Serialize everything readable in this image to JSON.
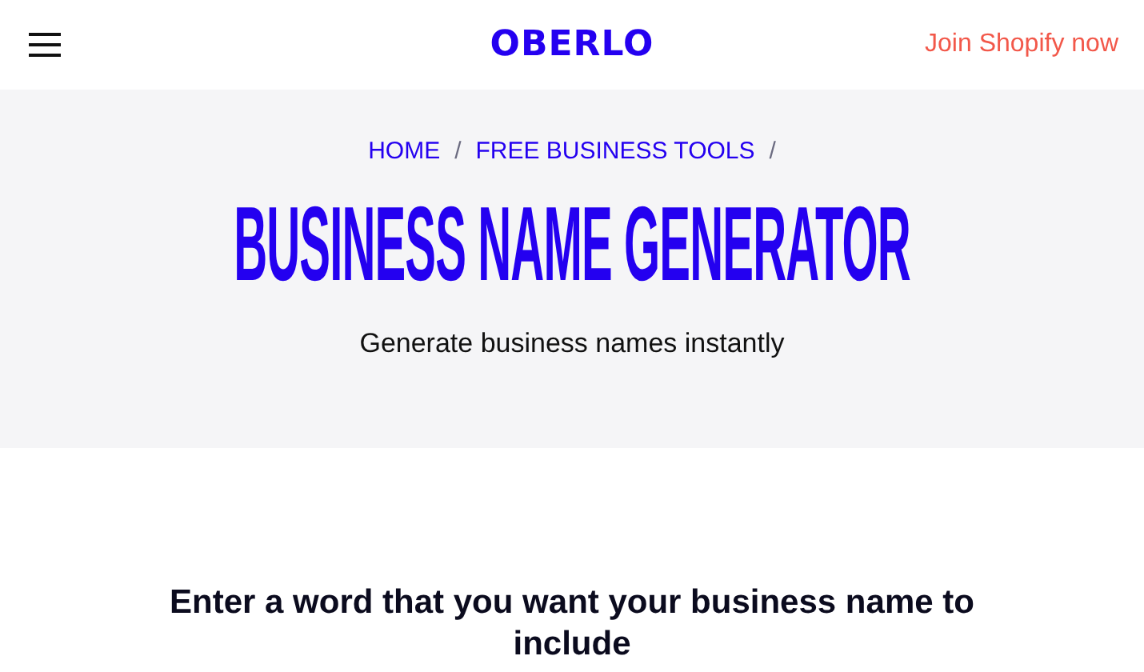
{
  "header": {
    "logo": "OBERLO",
    "cta": "Join Shopify now"
  },
  "breadcrumb": {
    "separator": "/",
    "items": [
      "HOME",
      "FREE BUSINESS TOOLS"
    ]
  },
  "hero": {
    "title": "BUSINESS NAME GENERATOR",
    "subtitle": "Generate business names instantly"
  },
  "prompt": "Enter a word that you want your business name to include"
}
